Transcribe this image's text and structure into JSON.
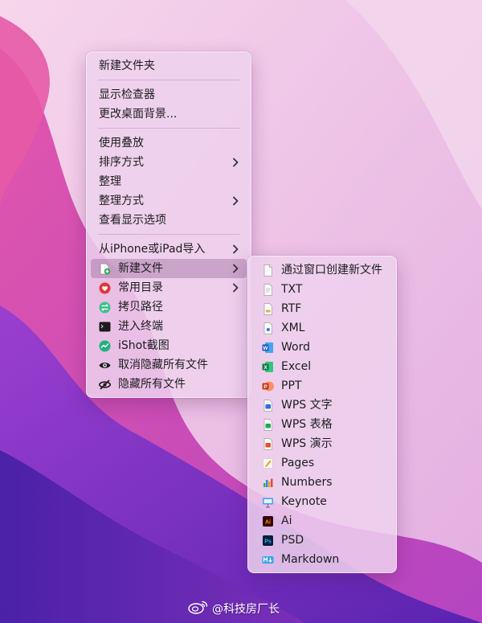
{
  "main_menu": {
    "new_folder": "新建文件夹",
    "show_inspector": "显示检查器",
    "change_background": "更改桌面背景...",
    "use_stacks": "使用叠放",
    "sort_by": "排序方式",
    "clean_up": "整理",
    "clean_up_by": "整理方式",
    "view_options": "查看显示选项",
    "import_from_iphone": "从iPhone或iPad导入",
    "new_file": "新建文件",
    "favorites": "常用目录",
    "copy_path": "拷贝路径",
    "open_terminal": "进入终端",
    "ishot": "iShot截图",
    "unhide_all": "取消隐藏所有文件",
    "hide_all": "隐藏所有文件"
  },
  "sub_menu": {
    "via_window": "通过窗口创建新文件",
    "txt": "TXT",
    "rtf": "RTF",
    "xml": "XML",
    "word": "Word",
    "excel": "Excel",
    "ppt": "PPT",
    "wps_text": "WPS 文字",
    "wps_sheet": "WPS 表格",
    "wps_present": "WPS 演示",
    "pages": "Pages",
    "numbers": "Numbers",
    "keynote": "Keynote",
    "ai": "Ai",
    "psd": "PSD",
    "markdown": "Markdown"
  },
  "watermark": {
    "text": "@科技房厂长"
  },
  "colors": {
    "menu_bg": "#eed2ee",
    "highlight": "#a06ea0",
    "word": "#2b5797",
    "excel": "#1e7145",
    "ppt": "#d24726",
    "psd": "#31a8ff",
    "ai": "#ff9a00"
  }
}
